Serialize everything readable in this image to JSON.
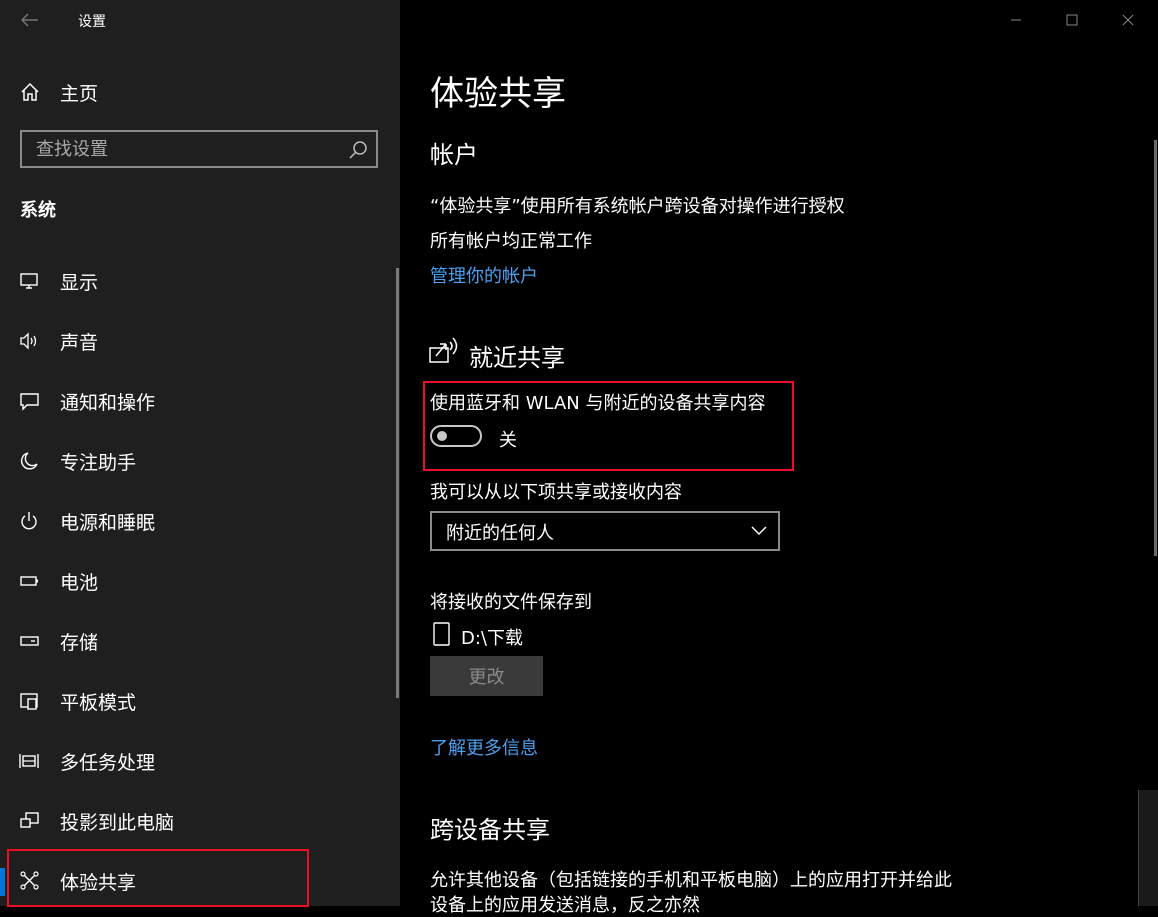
{
  "window": {
    "title": "设置",
    "minimize": "minimize",
    "maximize": "maximize",
    "close": "close"
  },
  "sidebar": {
    "home_label": "主页",
    "search_placeholder": "查找设置",
    "section": "系统",
    "items": [
      {
        "label": "显示",
        "icon": "monitor-icon"
      },
      {
        "label": "声音",
        "icon": "speaker-icon"
      },
      {
        "label": "通知和操作",
        "icon": "notification-icon"
      },
      {
        "label": "专注助手",
        "icon": "moon-icon"
      },
      {
        "label": "电源和睡眠",
        "icon": "power-icon"
      },
      {
        "label": "电池",
        "icon": "battery-icon"
      },
      {
        "label": "存储",
        "icon": "storage-icon"
      },
      {
        "label": "平板模式",
        "icon": "tablet-mode-icon"
      },
      {
        "label": "多任务处理",
        "icon": "multitask-icon"
      },
      {
        "label": "投影到此电脑",
        "icon": "project-icon"
      },
      {
        "label": "体验共享",
        "icon": "shared-experience-icon",
        "active": true
      }
    ]
  },
  "main": {
    "title": "体验共享",
    "accounts": {
      "heading": "帐户",
      "desc": "“体验共享”使用所有系统帐户跨设备对操作进行授权",
      "status": "所有帐户均正常工作",
      "manage_link": "管理你的帐户"
    },
    "nearby": {
      "heading": "就近共享",
      "toggle_label": "使用蓝牙和 WLAN 与附近的设备共享内容",
      "toggle_state": "关",
      "share_from_label": "我可以从以下项共享或接收内容",
      "share_from_value": "附近的任何人",
      "save_to_label": "将接收的文件保存到",
      "save_path": "D:\\下载",
      "change_button": "更改",
      "learn_more": "了解更多信息"
    },
    "cross_device": {
      "heading": "跨设备共享",
      "desc_line1": "允许其他设备（包括链接的手机和平板电脑）上的应用打开并给此",
      "desc_line2": "设备上的应用发送消息，反之亦然"
    }
  },
  "colors": {
    "accent": "#0078d7",
    "link": "#4aa0f0",
    "highlight": "#e81123",
    "sidebar_bg": "#1f1f1f"
  }
}
